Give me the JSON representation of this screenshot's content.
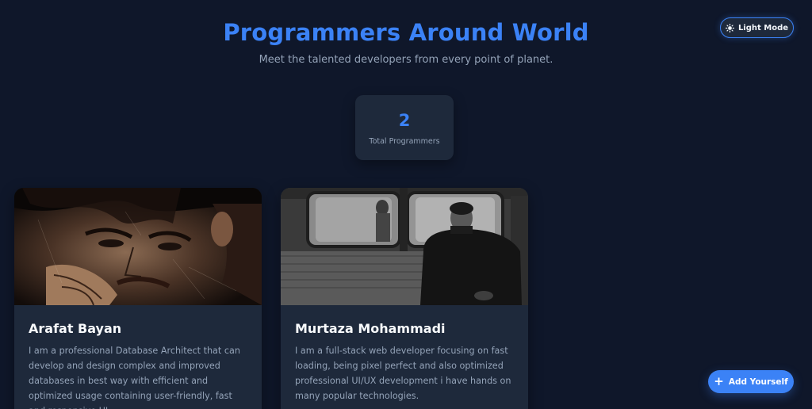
{
  "header": {
    "title": "Programmers Around World",
    "subtitle": "Meet the talented developers from every point of planet."
  },
  "theme_toggle": {
    "label": "Light Mode",
    "icon": "sun-icon"
  },
  "stats": {
    "total": "2",
    "label": "Total Programmers"
  },
  "programmers": [
    {
      "name": "Arafat Bayan",
      "bio": "I am a professional Database Architect that can develop and design complex and improved databases in best way with efficient and optimized usage containing user-friendly, fast and responsive UI...",
      "photo": "illustrated-portrait"
    },
    {
      "name": "Murtaza Mohammadi",
      "bio": "I am a full-stack web developer focusing on fast loading, being pixel perfect and also optimized professional UI/UX development i have hands on many popular technologies.",
      "photo": "subway-photo"
    }
  ],
  "add_button": {
    "label": "Add Yourself",
    "icon": "plus-icon"
  },
  "colors": {
    "background": "#0f172a",
    "card": "#1e293b",
    "accent": "#3b82f6",
    "muted_text": "#94a3b8"
  }
}
